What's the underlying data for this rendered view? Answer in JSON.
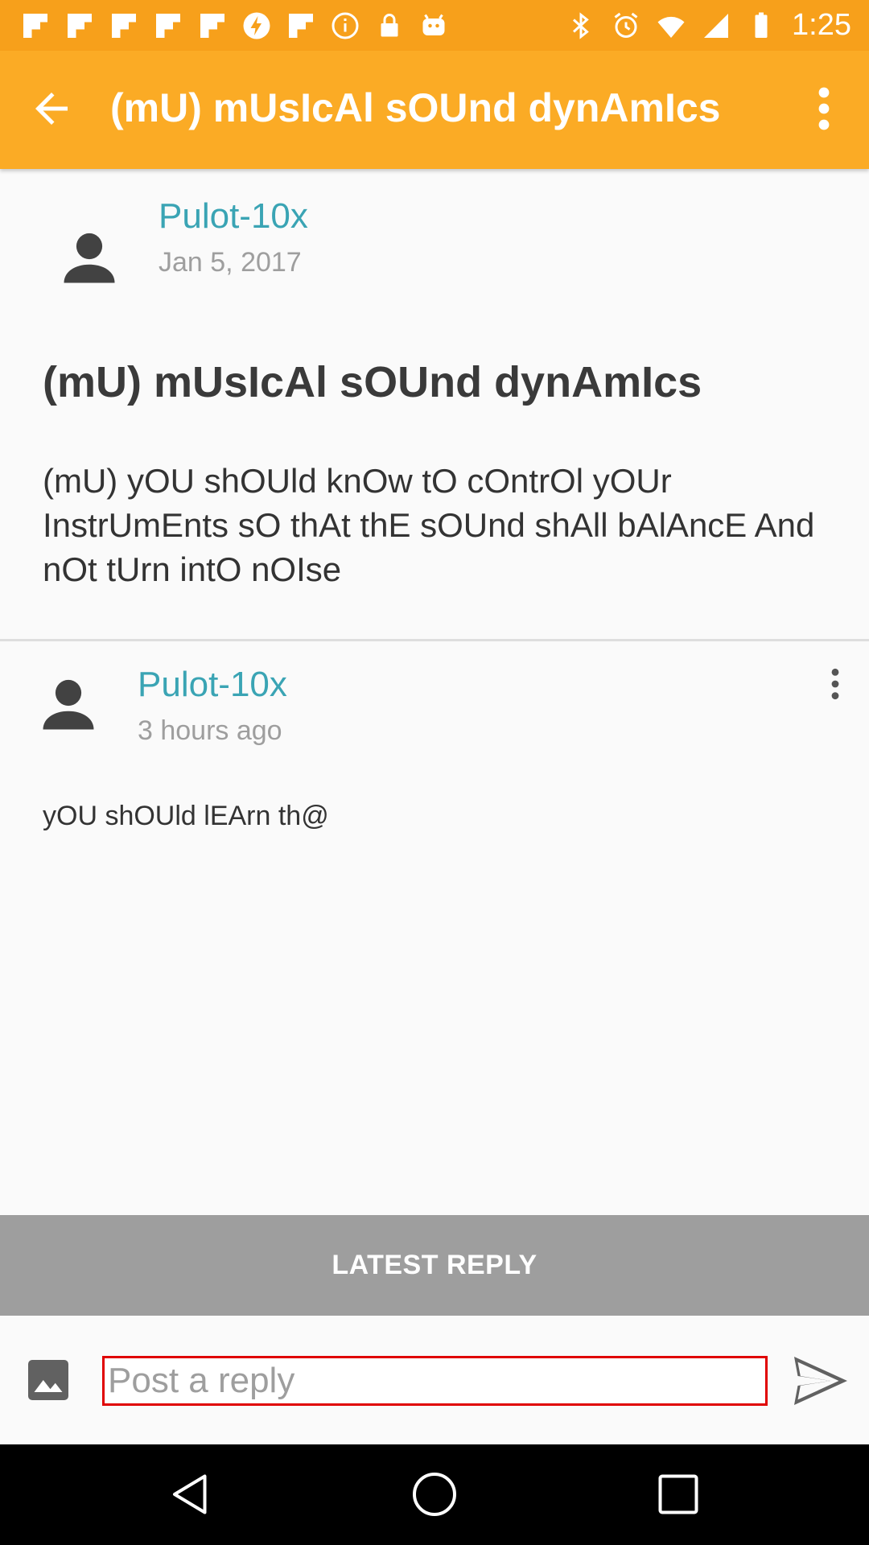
{
  "status_bar": {
    "time": "1:25",
    "notification_icons": [
      "flipboard-icon",
      "flipboard-icon",
      "flipboard-icon",
      "flipboard-icon",
      "flipboard-icon",
      "bolt-icon",
      "flipboard-icon",
      "info-icon",
      "lock-icon",
      "android-icon"
    ],
    "system_icons": [
      "bluetooth-icon",
      "alarm-icon",
      "wifi-icon",
      "signal-icon",
      "battery-icon"
    ]
  },
  "app_bar": {
    "title": "(mU) mUsIcAl sOUnd dynAmIcs",
    "back_icon": "arrow-back-icon",
    "menu_icon": "more-vert-icon"
  },
  "post": {
    "author": "Pulot-10x",
    "date": "Jan 5, 2017",
    "title": "(mU) mUsIcAl sOUnd dynAmIcs",
    "body": "(mU) yOU shOUld knOw tO cOntrOl yOUr InstrUmEnts sO thAt thE sOUnd shAll bAlAncE And nOt tUrn intO nOIse"
  },
  "reply": {
    "author": "Pulot-10x",
    "time": "3 hours ago",
    "body": "yOU shOUld lEArn th@"
  },
  "latest_reply_label": "LATEST REPLY",
  "composer": {
    "placeholder": "Post a reply",
    "value": ""
  },
  "colors": {
    "status_bar": "#f7a01b",
    "app_bar": "#fbab25",
    "username": "#3aa4b4",
    "latest_reply_bar": "#9e9e9e",
    "input_border": "#e00000"
  }
}
